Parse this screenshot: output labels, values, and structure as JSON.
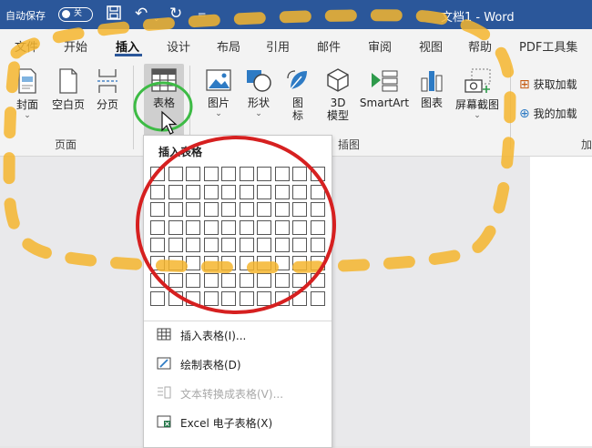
{
  "titlebar": {
    "autosave_label": "自动保存",
    "toggle_state": "关",
    "document_title": "文档1 - Word"
  },
  "tabs": [
    "文件",
    "开始",
    "插入",
    "设计",
    "布局",
    "引用",
    "邮件",
    "审阅",
    "视图",
    "帮助",
    "PDF工具集"
  ],
  "active_tab": "插入",
  "ribbon": {
    "pages_group": {
      "label": "页面",
      "buttons": {
        "cover": "封面",
        "blank": "空白页",
        "break": "分页"
      }
    },
    "table_button": "表格",
    "illustrations_group": {
      "label": "插图",
      "buttons": {
        "picture": "图片",
        "shape": "形状",
        "icon1": "图",
        "icon2": "标",
        "model1": "3D",
        "model2": "模型",
        "smartart": "SmartArt",
        "chart": "图表",
        "screenshot": "屏幕截图"
      }
    },
    "addins": {
      "get": "获取加载",
      "mine": "我的加载",
      "group_label": "加"
    }
  },
  "dropdown": {
    "header": "插入表格",
    "items": {
      "insert_table": "插入表格(I)...",
      "draw_table": "绘制表格(D)",
      "convert_text": "文本转换成表格(V)...",
      "excel_table": "Excel 电子表格(X)"
    }
  },
  "colors": {
    "titlebar": "#2b579a",
    "annotation_green": "#3dbb45",
    "annotation_red": "#d62020",
    "annotation_orange": "#f5b52e"
  }
}
